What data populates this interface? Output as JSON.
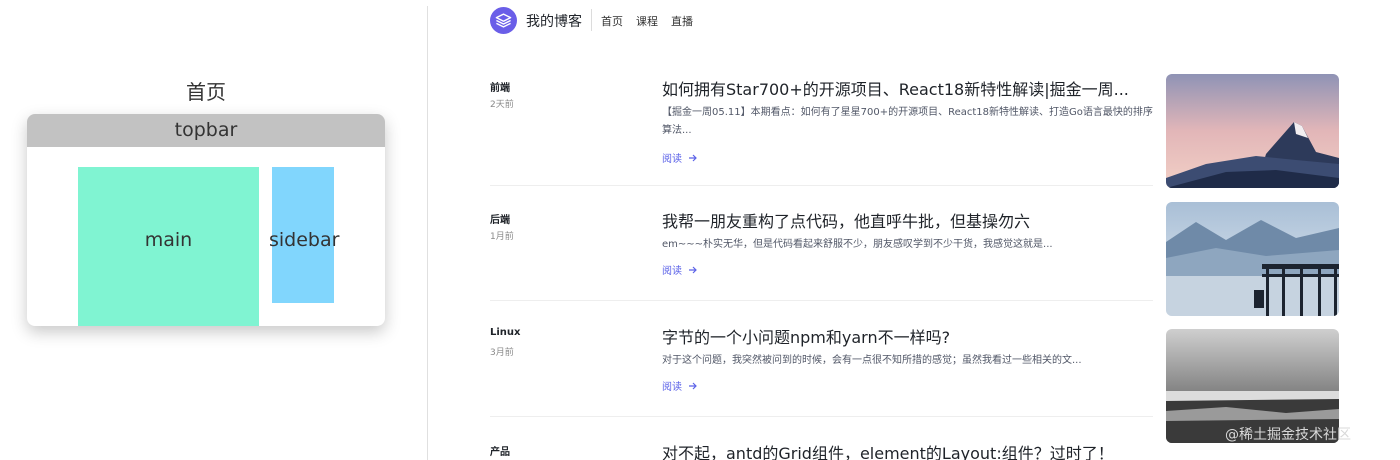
{
  "diagram": {
    "title": "首页",
    "topbar": "topbar",
    "main": "main",
    "sidebar": "sidebar"
  },
  "header": {
    "site_name": "我的博客",
    "nav": [
      "首页",
      "课程",
      "直播"
    ]
  },
  "articles": [
    {
      "category": "前端",
      "time": "2天前",
      "title": "如何拥有Star700+的开源项目、React18新特性解读|掘金一周...",
      "summary": "【掘金一周05.11】本期看点：如何有了星星700+的开源项目、React18新特性解读、打造Go语言最快的排序算法...",
      "read": "阅读",
      "image": "mountain-peak-sunset"
    },
    {
      "category": "后端",
      "time": "1月前",
      "title": "我帮一朋友重构了点代码，他直呼牛批，但基操勿六",
      "summary": "em~~~朴实无华，但是代码看起来舒服不少，朋友感叹学到不少干货，我感觉这就是...",
      "read": "阅读",
      "image": "lake-pier-mountains"
    },
    {
      "category": "Linux",
      "time": "3月前",
      "title": "字节的一个小问题npm和yarn不一样吗?",
      "summary": "对于这个问题，我突然被问到的时候，会有一点很不知所措的感觉；虽然我看过一些相关的文...",
      "read": "阅读",
      "image": "grayscale-beach"
    },
    {
      "category": "产品",
      "time": "",
      "title": "对不起，antd的Grid组件，element的Layout:组件？过时了！",
      "summary": "",
      "read": "",
      "image": ""
    }
  ],
  "watermark": "@稀土掘金技术社区",
  "colors": {
    "accent": "#5b62e8",
    "logo": "#6a5ee8",
    "main_block": "#80f4d2",
    "sidebar_block": "#81d6fd",
    "topbar_block": "#c2c2c2"
  }
}
